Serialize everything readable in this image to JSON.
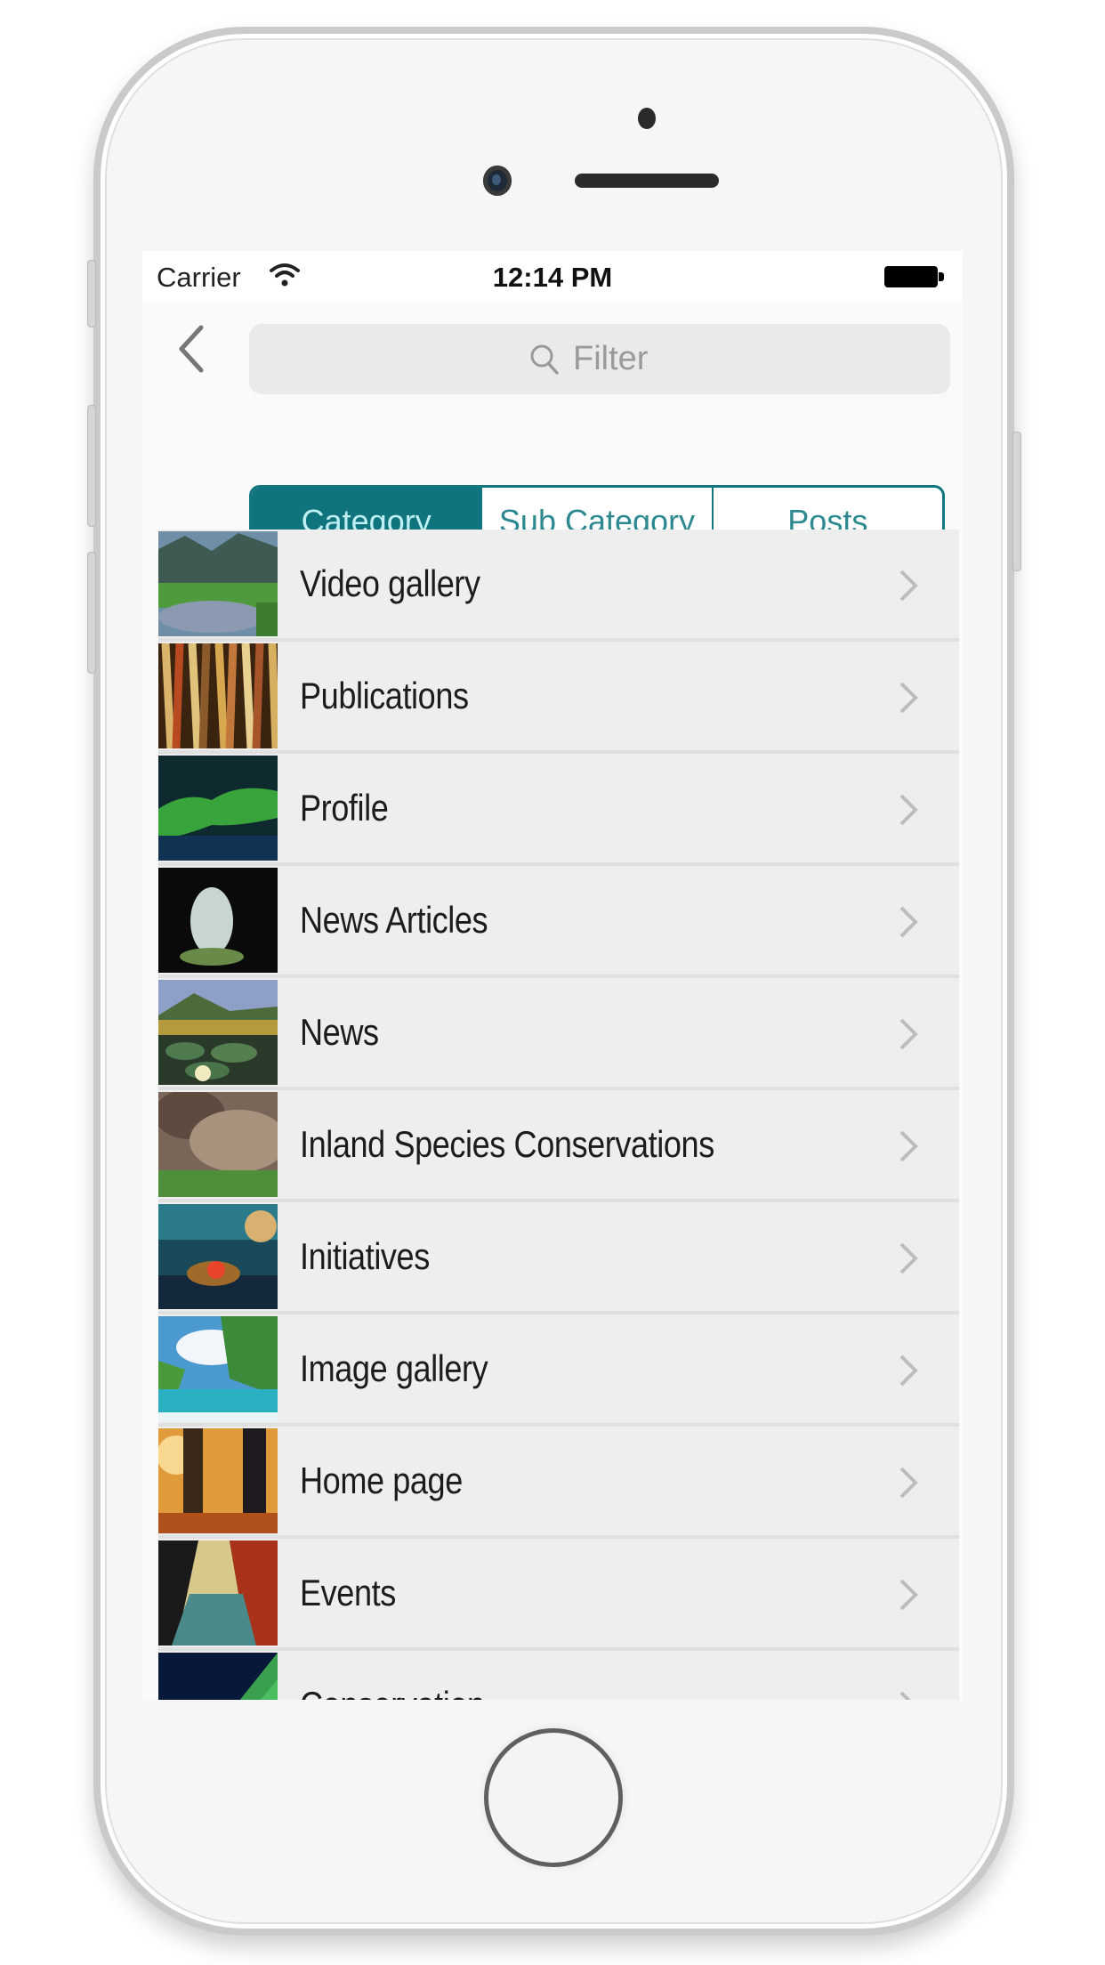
{
  "status_bar": {
    "carrier": "Carrier",
    "time": "12:14 PM",
    "wifi_icon": "wifi-icon",
    "battery_icon": "battery-icon"
  },
  "nav": {
    "back_icon": "chevron-left-icon",
    "filter": {
      "placeholder": "Filter",
      "value": "",
      "icon": "search-icon"
    }
  },
  "segments": {
    "items": [
      {
        "label": "Category",
        "active": true
      },
      {
        "label": "Sub Category",
        "active": false
      },
      {
        "label": "Posts",
        "active": false
      }
    ]
  },
  "list": {
    "items": [
      {
        "label": "Video gallery",
        "thumb": "mountain-lake-image"
      },
      {
        "label": "Publications",
        "thumb": "books-image"
      },
      {
        "label": "Profile",
        "thumb": "moss-log-image"
      },
      {
        "label": "News Articles",
        "thumb": "cave-waterfall-image"
      },
      {
        "label": "News",
        "thumb": "lily-pads-image"
      },
      {
        "label": "Inland Species Conservations",
        "thumb": "rocks-grass-image"
      },
      {
        "label": "Initiatives",
        "thumb": "underwater-flower-image"
      },
      {
        "label": "Image gallery",
        "thumb": "turquoise-river-image"
      },
      {
        "label": "Home page",
        "thumb": "autumn-forest-image"
      },
      {
        "label": "Events",
        "thumb": "forest-road-image"
      },
      {
        "label": "Conservation",
        "thumb": "green-leaf-image"
      }
    ]
  },
  "colors": {
    "accent": "#0f747e",
    "accent_text": "#bfeff2",
    "row_bg": "#eeeeee"
  }
}
